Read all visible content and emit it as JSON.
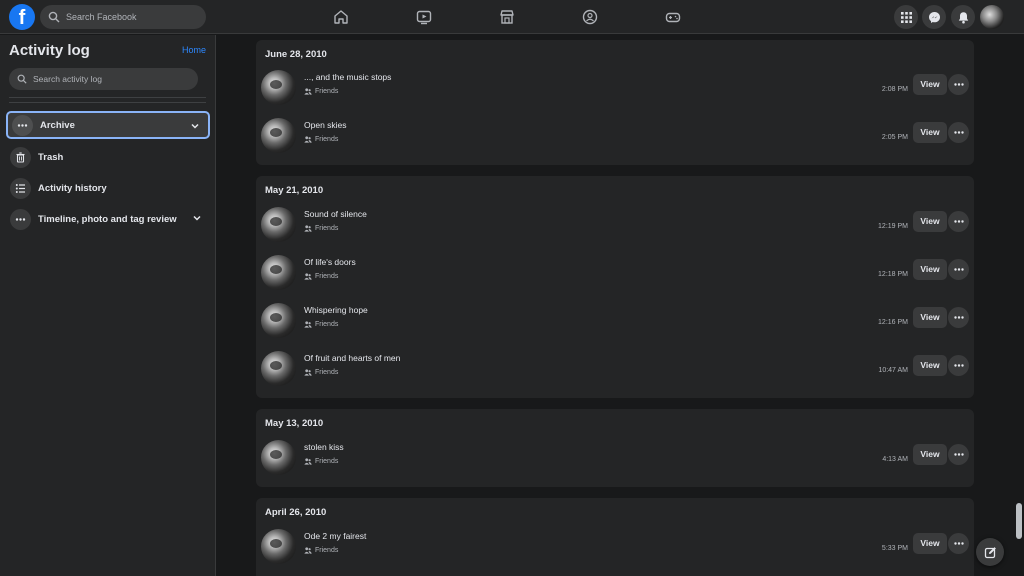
{
  "topbar": {
    "logo": "f",
    "search_placeholder": "Search Facebook",
    "nav_icons": [
      "home-icon",
      "watch-icon",
      "marketplace-icon",
      "groups-icon",
      "gaming-icon"
    ],
    "right_icons": [
      "menu-grid-icon",
      "messenger-icon",
      "notifications-icon"
    ]
  },
  "sidebar": {
    "title": "Activity log",
    "home_link": "Home",
    "search_placeholder": "Search activity log",
    "items": [
      {
        "label": "Archive",
        "icon": "more-dots-icon",
        "active": true,
        "expandable": true
      },
      {
        "label": "Trash",
        "icon": "trash-icon",
        "active": false,
        "expandable": false
      },
      {
        "label": "Activity history",
        "icon": "list-icon",
        "active": false,
        "expandable": false
      },
      {
        "label": "Timeline, photo and tag review",
        "icon": "more-dots-icon",
        "active": false,
        "expandable": true
      }
    ]
  },
  "feed": {
    "view_label": "View",
    "groups": [
      {
        "date": "June 28, 2010",
        "entries": [
          {
            "title": "..., and the music stops",
            "audience": "Friends",
            "time": "2:08 PM"
          },
          {
            "title": "Open skies",
            "audience": "Friends",
            "time": "2:05 PM"
          }
        ]
      },
      {
        "date": "May 21, 2010",
        "entries": [
          {
            "title": "Sound of silence",
            "audience": "Friends",
            "time": "12:19 PM"
          },
          {
            "title": "Of life's doors",
            "audience": "Friends",
            "time": "12:18 PM"
          },
          {
            "title": "Whispering hope",
            "audience": "Friends",
            "time": "12:16 PM"
          },
          {
            "title": "Of fruit and hearts of men",
            "audience": "Friends",
            "time": "10:47 AM"
          }
        ]
      },
      {
        "date": "May 13, 2010",
        "entries": [
          {
            "title": "stolen kiss",
            "audience": "Friends",
            "time": "4:13 AM"
          }
        ]
      },
      {
        "date": "April 26, 2010",
        "entries": [
          {
            "title": "Ode 2 my fairest",
            "audience": "Friends",
            "time": "5:33 PM"
          }
        ]
      }
    ]
  },
  "colors": {
    "accent": "#1877f2",
    "link": "#2d88ff",
    "background": "#18191a",
    "surface": "#242526",
    "active_outline": "#8ab4f8"
  }
}
